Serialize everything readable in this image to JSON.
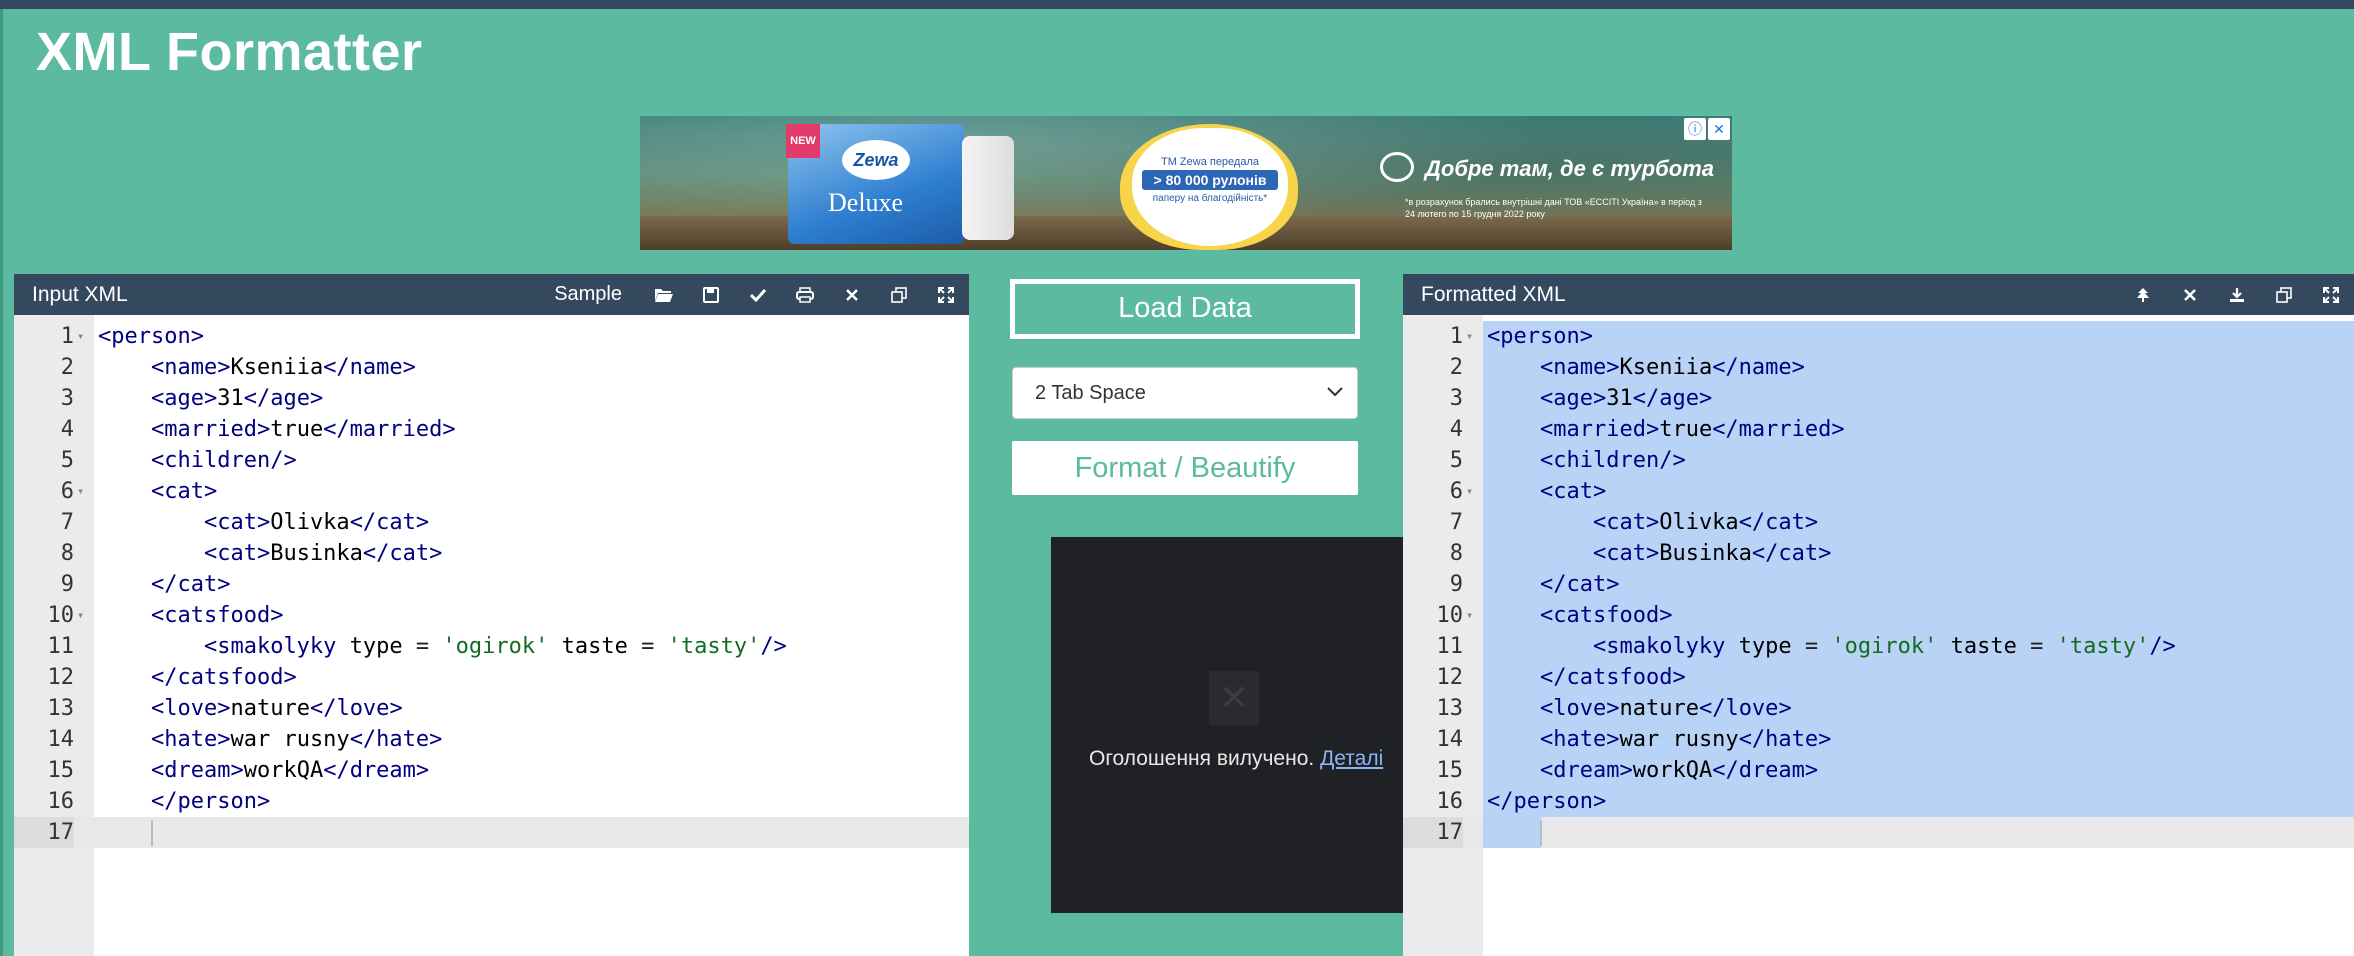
{
  "app": {
    "title": "XML Formatter"
  },
  "ad_banner": {
    "new_tag": "NEW",
    "brand": "Zewa",
    "product": "Deluxe",
    "heart_line1": "ТМ Zewa передала",
    "heart_line2": "> 80 000 рулонів",
    "heart_line3": "паперу на благодійність*",
    "slogan": "Добре там, де є турбота",
    "fine_print": "*в розрахунок брались внутрішні дані ТОВ «ЕССІТІ Україна» в період з 24 лютего по 15 грудня 2022 року",
    "info_icon": "info-icon",
    "close_icon": "close-icon"
  },
  "input_panel": {
    "title": "Input XML",
    "sample_label": "Sample",
    "toolbar_icons": [
      "folder-open-icon",
      "save-icon",
      "check-icon",
      "print-icon",
      "clear-icon",
      "copy-icon",
      "fullscreen-icon"
    ],
    "lines": [
      "<person>",
      "    <name>Kseniia</name>",
      "    <age>31</age>",
      "    <married>true</married>",
      "    <children/>",
      "    <cat>",
      "        <cat>Olivka</cat>",
      "        <cat>Businka</cat>",
      "    </cat>",
      "    <catsfood>",
      "        <smakolyky type = 'ogirok' taste = 'tasty'/>",
      "    </catsfood>",
      "    <love>nature</love>",
      "    <hate>war rusny</hate>",
      "    <dream>workQA</dream>",
      "    </person>",
      ""
    ]
  },
  "middle": {
    "load_label": "Load Data",
    "indent_selected": "2 Tab Space",
    "format_label": "Format / Beautify",
    "removed_ad_text": "Оголошення вилучено.",
    "removed_ad_link": "Деталі"
  },
  "output_panel": {
    "title": "Formatted XML",
    "toolbar_icons": [
      "tree-icon",
      "clear-icon",
      "download-icon",
      "copy-icon",
      "fullscreen-icon"
    ],
    "lines": [
      "<person>",
      "    <name>Kseniia</name>",
      "    <age>31</age>",
      "    <married>true</married>",
      "    <children/>",
      "    <cat>",
      "        <cat>Olivka</cat>",
      "        <cat>Businka</cat>",
      "    </cat>",
      "    <catsfood>",
      "        <smakolyky type = 'ogirok' taste = 'tasty'/>",
      "    </catsfood>",
      "    <love>nature</love>",
      "    <hate>war rusny</hate>",
      "    <dream>workQA</dream>",
      "</person>",
      ""
    ]
  },
  "fold_lines": [
    1,
    6,
    10
  ],
  "colors": {
    "background": "#5bba9f",
    "header": "#34495e",
    "tag": "#000080",
    "string": "#116c1e",
    "selection": "#b9d3f6"
  }
}
